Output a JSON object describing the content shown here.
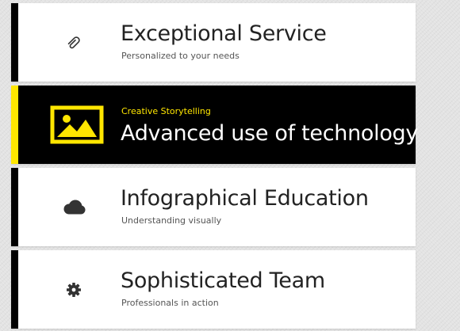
{
  "colors": {
    "accent": "#ffe600",
    "dark": "#000000",
    "card": "#ffffff",
    "page_background": "#e3e3e3",
    "title_text": "#222222",
    "subtitle_text": "#555555",
    "icon": "#333333"
  },
  "features": [
    {
      "title": "Exceptional Service",
      "subtitle": "Personalized to your needs",
      "icon": "paperclip-icon",
      "active": false
    },
    {
      "eyebrow": "Creative Storytelling",
      "title": "Advanced use of technology",
      "icon": "image-icon",
      "active": true
    },
    {
      "title": "Infographical Education",
      "subtitle": "Understanding visually",
      "icon": "cloud-icon",
      "active": false
    },
    {
      "title": "Sophisticated Team",
      "subtitle": "Professionals in action",
      "icon": "gear-icon",
      "active": false
    }
  ]
}
